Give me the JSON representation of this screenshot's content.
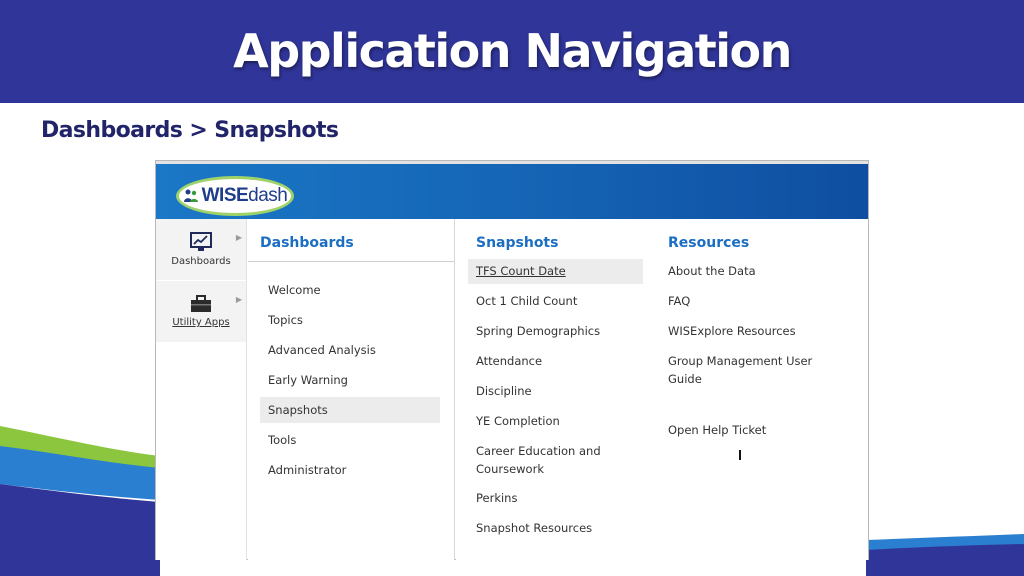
{
  "slide": {
    "title": "Application Navigation",
    "breadcrumb": "Dashboards > Snapshots",
    "colors": {
      "title_bar": "#303599",
      "accent_green": "#8cc63f",
      "accent_blue": "#2a7fd0"
    }
  },
  "app": {
    "logo_text_a": "WISE",
    "logo_text_b": "dash",
    "logo_icon": "people-icon",
    "sidebar": {
      "items": [
        {
          "label": "Dashboards",
          "icon": "chart-monitor-icon"
        },
        {
          "label": "Utility Apps",
          "icon": "toolbox-icon"
        }
      ]
    },
    "dashboards_menu": {
      "heading": "Dashboards",
      "items": [
        "Welcome",
        "Topics",
        "Advanced Analysis",
        "Early Warning",
        "Snapshots",
        "Tools",
        "Administrator"
      ],
      "active": "Snapshots"
    },
    "snapshots_menu": {
      "heading": "Snapshots",
      "items": [
        "TFS Count Date",
        "Oct 1 Child Count",
        "Spring Demographics",
        "Attendance",
        "Discipline",
        "YE Completion",
        "Career Education and Coursework",
        "Perkins",
        "Snapshot Resources"
      ],
      "hovered": "TFS Count Date"
    },
    "resources_menu": {
      "heading": "Resources",
      "items": [
        "About the Data",
        "FAQ",
        "WISExplore Resources",
        "Group Management User Guide",
        "Open Help Ticket"
      ]
    }
  }
}
